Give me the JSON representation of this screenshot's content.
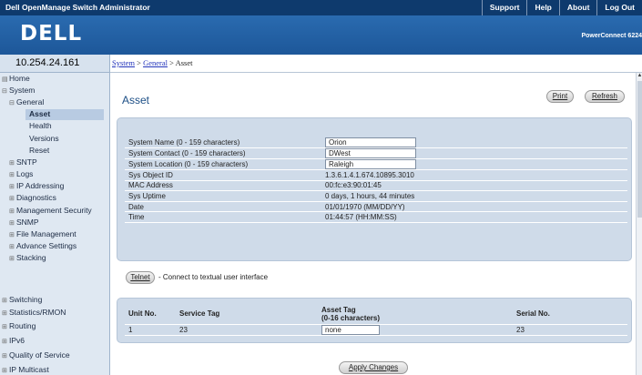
{
  "topbar": {
    "app_title": "Dell OpenManage Switch Administrator",
    "links": [
      "Support",
      "Help",
      "About",
      "Log Out"
    ]
  },
  "banner": {
    "logo_text": "DELL",
    "model": "PowerConnect 6224"
  },
  "ip_address": "10.254.24.161",
  "breadcrumb": {
    "system": "System",
    "sep1": " > ",
    "general": "General",
    "sep2": " > ",
    "current": "Asset"
  },
  "nav": [
    {
      "label": "Home",
      "icon": "home-icon"
    },
    {
      "label": "System",
      "icon": "minus-box-icon"
    },
    {
      "label": "General",
      "icon": "minus-box-icon"
    },
    {
      "label": "Asset",
      "icon": "",
      "active": true
    },
    {
      "label": "Health",
      "icon": ""
    },
    {
      "label": "Versions",
      "icon": ""
    },
    {
      "label": "Reset",
      "icon": ""
    },
    {
      "label": "SNTP",
      "icon": "plus-box-icon"
    },
    {
      "label": "Logs",
      "icon": "plus-box-icon"
    },
    {
      "label": "IP Addressing",
      "icon": "plus-box-icon"
    },
    {
      "label": "Diagnostics",
      "icon": "plus-box-icon"
    },
    {
      "label": "Management Security",
      "icon": "plus-box-icon"
    },
    {
      "label": "SNMP",
      "icon": "plus-box-icon"
    },
    {
      "label": "File Management",
      "icon": "plus-box-icon"
    },
    {
      "label": "Advance Settings",
      "icon": "plus-box-icon"
    },
    {
      "label": "Stacking",
      "icon": "plus-box-icon"
    },
    {
      "label": "Switching",
      "icon": "plus-box-icon"
    },
    {
      "label": "Statistics/RMON",
      "icon": "plus-box-icon"
    },
    {
      "label": "Routing",
      "icon": "plus-box-icon"
    },
    {
      "label": "IPv6",
      "icon": "plus-box-icon"
    },
    {
      "label": "Quality of Service",
      "icon": "plus-box-icon"
    },
    {
      "label": "IP Multicast",
      "icon": "plus-box-icon"
    }
  ],
  "page": {
    "title": "Asset",
    "print_label": "Print",
    "refresh_label": "Refresh"
  },
  "system_info": {
    "system_name_label": "System Name (0 - 159 characters)",
    "system_name_value": "Orion",
    "system_contact_label": "System Contact (0 - 159 characters)",
    "system_contact_value": "DWest",
    "system_location_label": "System Location (0 - 159 characters)",
    "system_location_value": "Raleigh",
    "sys_object_id_label": "Sys Object ID",
    "sys_object_id_value": "1.3.6.1.4.1.674.10895.3010",
    "mac_address_label": "MAC Address",
    "mac_address_value": "00:fc:e3:90:01:45",
    "sys_uptime_label": "Sys Uptime",
    "sys_uptime_value": "0 days, 1 hours, 44 minutes",
    "date_label": "Date",
    "date_value": "01/01/1970 (MM/DD/YY)",
    "time_label": "Time",
    "time_value": "01:44:57 (HH:MM:SS)"
  },
  "telnet": {
    "button_label": "Telnet",
    "description": "- Connect to textual user interface"
  },
  "unit_table": {
    "headers": {
      "unit_no": "Unit No.",
      "service_tag": "Service Tag",
      "asset_tag": "Asset Tag",
      "asset_tag_sub": "(0-16 characters)",
      "serial_no": "Serial No."
    },
    "row": {
      "unit_no": "1",
      "service_tag": "23",
      "asset_tag": "none",
      "serial_no": "23"
    }
  },
  "apply_label": "Apply Changes"
}
